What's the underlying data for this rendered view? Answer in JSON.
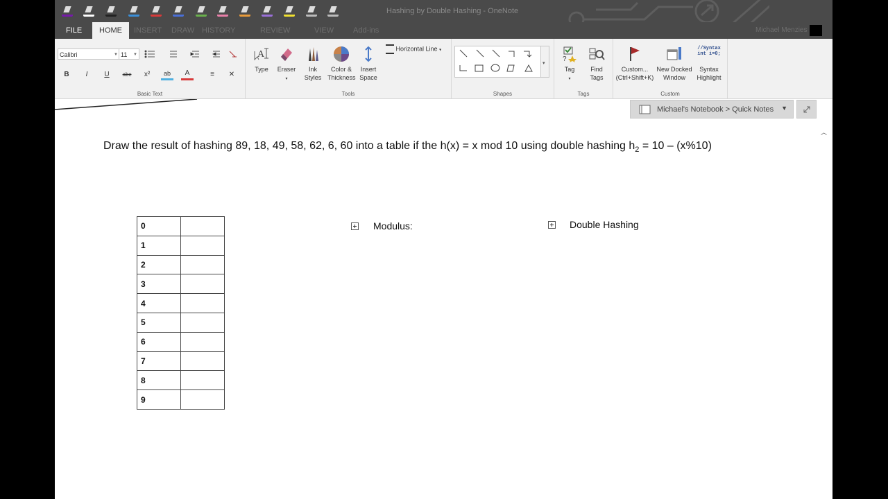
{
  "window": {
    "title": "Hashing by Double Hashing - OneNote",
    "user_name": "Michael Menzies"
  },
  "quick_access": [
    {
      "icon": "onenote-logo-icon",
      "color": "#7719aa"
    },
    {
      "icon": "back-icon",
      "color": "#ffffff"
    },
    {
      "icon": "pen-black-icon",
      "color": "#222222"
    },
    {
      "icon": "pen-blue-icon",
      "color": "#3a8ed8"
    },
    {
      "icon": "pen-red-icon",
      "color": "#d83a3a"
    },
    {
      "icon": "pen-blue2-icon",
      "color": "#4a6fd8"
    },
    {
      "icon": "pen-green-icon",
      "color": "#6ab04c"
    },
    {
      "icon": "pen-pink-icon",
      "color": "#e87fa8"
    },
    {
      "icon": "pen-orange-icon",
      "color": "#e89a3a"
    },
    {
      "icon": "pen-purple-icon",
      "color": "#9a6fd8"
    },
    {
      "icon": "highlighter-yellow-icon",
      "color": "#f0e030"
    },
    {
      "icon": "lasso-icon",
      "color": "#bbbbbb"
    },
    {
      "icon": "touch-mode-icon",
      "color": "#bbbbbb"
    }
  ],
  "tabs": [
    {
      "label": "FILE",
      "state": "file"
    },
    {
      "label": "HOME",
      "state": "active"
    },
    {
      "label": "INSERT",
      "state": "dim"
    },
    {
      "label": "DRAW",
      "state": "dim"
    },
    {
      "label": "HISTORY",
      "state": "dim"
    },
    {
      "label": "REVIEW",
      "state": "dim"
    },
    {
      "label": "VIEW",
      "state": "dim"
    },
    {
      "label": "Add-ins",
      "state": "dim"
    }
  ],
  "ribbon": {
    "basic_text": {
      "font": "Calibri",
      "size": "11",
      "label": "Basic Text",
      "format_buttons": [
        "B",
        "I",
        "U",
        "abc",
        "x²",
        "ab",
        "A",
        "≡",
        "✕"
      ]
    },
    "tools": {
      "label": "Tools",
      "type": "Type",
      "eraser": "Eraser",
      "ink_styles": "Ink Styles",
      "color_thickness": "Color & Thickness",
      "insert_space": "Insert Space",
      "horizontal_line": "Horizontal Line"
    },
    "shapes": {
      "label": "Shapes"
    },
    "tags": {
      "label": "Tags",
      "tag": "Tag",
      "find_tags": "Find Tags"
    },
    "custom": {
      "label": "Custom",
      "custom_btn": "Custom... (Ctrl+Shift+K)",
      "new_docked": "New Docked Window",
      "syntax": "Syntax Highlight",
      "syntax_icon_text": "//Syntax int i=0;"
    }
  },
  "notebook": {
    "label": "Michael's Notebook > Quick Notes"
  },
  "page": {
    "question": "Draw the result of hashing 89, 18, 49, 58, 62, 6, 60 into a table if the h(x) = x mod 10 using double hashing  h",
    "question_sub": "2",
    "question_tail": " = 10 – (x%10)",
    "table_rows": [
      "0",
      "1",
      "2",
      "3",
      "4",
      "5",
      "6",
      "7",
      "8",
      "9"
    ],
    "modulus_label": "Modulus:",
    "double_hashing_label": "Double Hashing"
  }
}
